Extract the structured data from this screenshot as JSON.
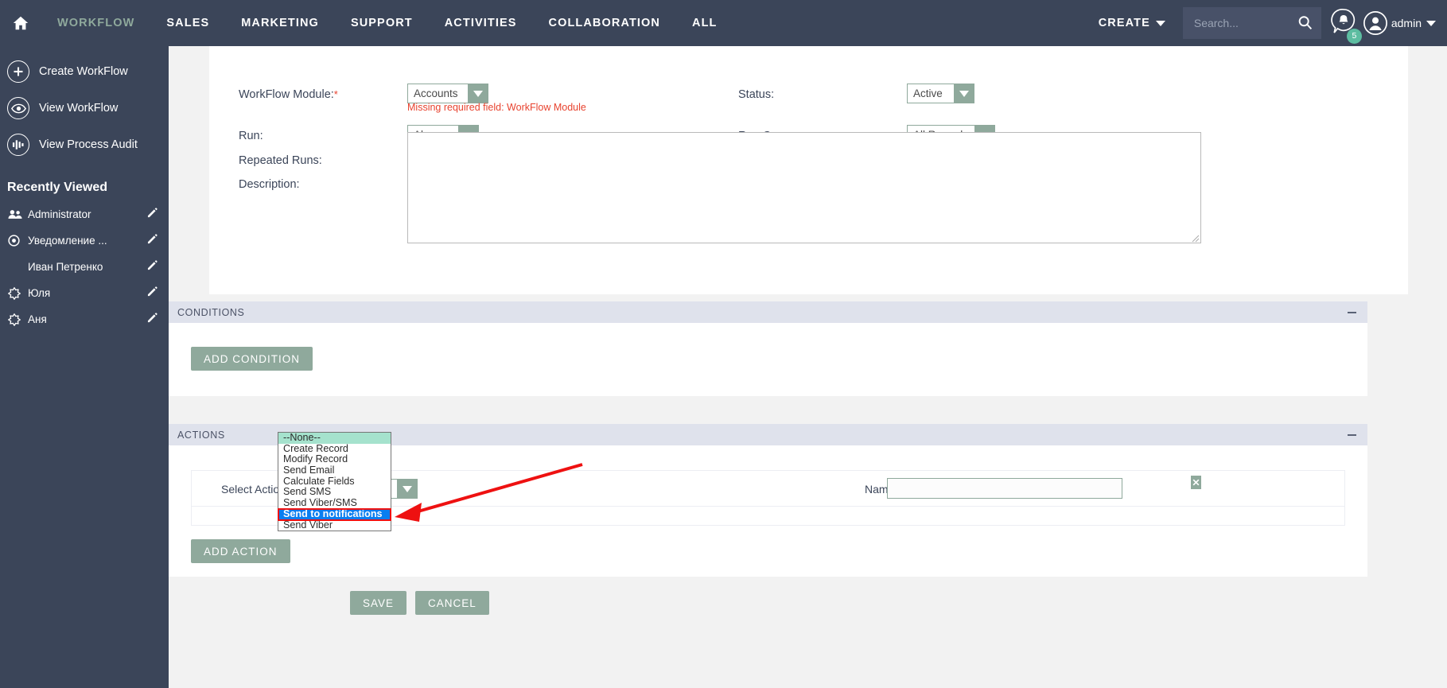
{
  "topnav": {
    "home_icon": "home-icon",
    "items": [
      {
        "label": "WORKFLOW",
        "active": true
      },
      {
        "label": "SALES",
        "active": false
      },
      {
        "label": "MARKETING",
        "active": false
      },
      {
        "label": "SUPPORT",
        "active": false
      },
      {
        "label": "ACTIVITIES",
        "active": false
      },
      {
        "label": "COLLABORATION",
        "active": false
      },
      {
        "label": "ALL",
        "active": false
      }
    ],
    "create_label": "CREATE",
    "search_placeholder": "Search...",
    "search_value": "",
    "notification_count": "5",
    "user_name": "admin"
  },
  "sidebar": {
    "actions": [
      {
        "label": "Create WorkFlow",
        "icon": "plus-circle-icon"
      },
      {
        "label": "View WorkFlow",
        "icon": "eye-circle-icon"
      },
      {
        "label": "View Process Audit",
        "icon": "audit-circle-icon"
      }
    ],
    "recent_title": "Recently Viewed",
    "recent": [
      {
        "label": "Administrator",
        "icon": "users-icon"
      },
      {
        "label": "Уведомление ...",
        "icon": "target-icon"
      },
      {
        "label": "Иван Петренко",
        "icon": "none"
      },
      {
        "label": "Юля",
        "icon": "star-icon"
      },
      {
        "label": "Аня",
        "icon": "star-icon"
      }
    ]
  },
  "form": {
    "workflow_module_label": "WorkFlow Module:",
    "workflow_module_value": "Accounts",
    "workflow_module_error": "Missing required field: WorkFlow Module",
    "status_label": "Status:",
    "status_value": "Active",
    "run_label": "Run:",
    "run_value": "Always",
    "run_on_label": "Run On:",
    "run_on_value": "All Records",
    "repeated_runs_label": "Repeated Runs:",
    "repeated_runs_checked": false,
    "description_label": "Description:",
    "description_value": ""
  },
  "conditions": {
    "title": "CONDITIONS",
    "add_button": "ADD CONDITION"
  },
  "actions": {
    "title": "ACTIONS",
    "select_action_label": "Select Action:",
    "select_action_value": "--None--",
    "name_label": "Name:",
    "name_value": "",
    "add_button": "ADD ACTION",
    "dropdown_options": [
      "--None--",
      "Create Record",
      "Modify Record",
      "Send Email",
      "Calculate Fields",
      "Send SMS",
      "Send Viber/SMS",
      "Send to notifications",
      "Send Viber"
    ],
    "dropdown_highlighted": "Send to notifications"
  },
  "footer": {
    "save_label": "SAVE",
    "cancel_label": "CANCEL"
  },
  "colors": {
    "header_bg": "#3b4559",
    "accent_green": "#8fa99c",
    "error_red": "#e8432f",
    "highlight_blue": "#0a7ef0",
    "annotation_red": "#ee1111",
    "section_bg": "#dfe2ec"
  }
}
